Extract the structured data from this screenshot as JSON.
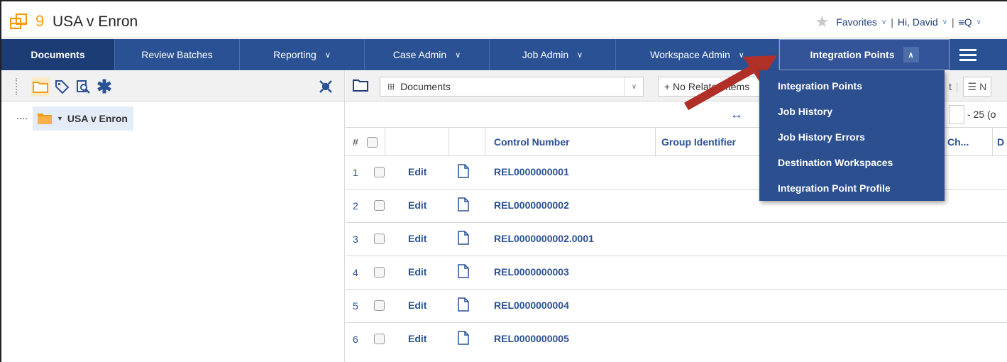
{
  "app": {
    "title": "USA v Enron",
    "logo_number": "9",
    "favorites_label": "Favorites",
    "greeting": "Hi, David",
    "search_label": "≡Q"
  },
  "nav": {
    "tabs": [
      {
        "label": "Documents"
      },
      {
        "label": "Review Batches"
      },
      {
        "label": "Reporting"
      },
      {
        "label": "Case Admin"
      },
      {
        "label": "Job Admin"
      },
      {
        "label": "Workspace Admin"
      },
      {
        "label": "Integration Points"
      }
    ]
  },
  "tree": {
    "root_label": "USA v Enron"
  },
  "toolbar": {
    "view_select": "Documents",
    "related_select": "+ No Related Items",
    "right_partial": "t",
    "right_partial2": "N"
  },
  "pager": {
    "text": "- 25 (o"
  },
  "grid": {
    "headers": {
      "hash": "#",
      "control_number": "Control Number",
      "group_identifier": "Group Identifier",
      "partial_col": "Ch...",
      "partial_col2": "D"
    },
    "edit_label": "Edit",
    "rows": [
      {
        "num": "1",
        "control": "REL0000000001"
      },
      {
        "num": "2",
        "control": "REL0000000002"
      },
      {
        "num": "3",
        "control": "REL0000000002.0001"
      },
      {
        "num": "4",
        "control": "REL0000000003"
      },
      {
        "num": "5",
        "control": "REL0000000004"
      },
      {
        "num": "6",
        "control": "REL0000000005"
      }
    ]
  },
  "menu": {
    "items": [
      {
        "label": "Integration Points"
      },
      {
        "label": "Job History"
      },
      {
        "label": "Job History Errors"
      },
      {
        "label": "Destination Workspaces"
      },
      {
        "label": "Integration Point Profile"
      }
    ]
  },
  "colors": {
    "nav_bg": "#2a5194",
    "nav_active": "#1c3c75",
    "menu_bg": "#2c4f8f",
    "link": "#2a5194",
    "logo_orange": "#f39c12",
    "arrow_red": "#b03028"
  }
}
